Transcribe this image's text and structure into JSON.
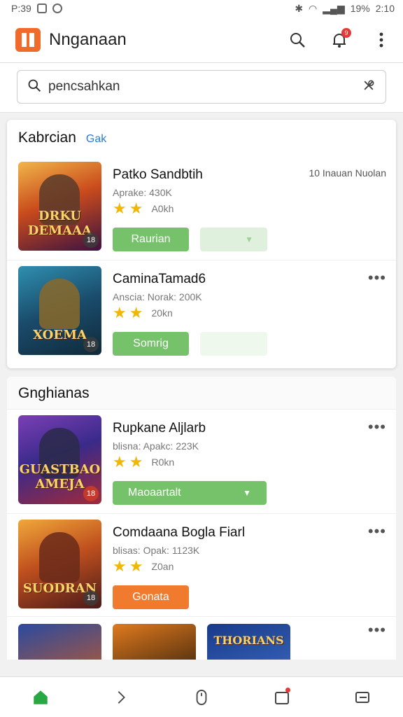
{
  "status": {
    "left": "P:39",
    "battery": "19%",
    "time": "2:10"
  },
  "app": {
    "title": "Nnganaan",
    "notification_count": "9"
  },
  "search": {
    "value": "pencsahkan"
  },
  "featured": {
    "title": "Kabrcian",
    "link": "Gak",
    "games": [
      {
        "title": "Patko Sandbtih",
        "meta": "Aprake: 430K",
        "size": "A0kh",
        "note": "10  Inauan Nuolan",
        "primary": "Raurian",
        "thumb_text": "DRKU DEMAAA",
        "thumb_badge": "18",
        "theme": "a"
      },
      {
        "title": "CaminaTamad6",
        "meta": "Anscia: Norak: 200K",
        "size": "20kn",
        "primary": "Somrig",
        "thumb_text": "XOEMA",
        "thumb_badge": "18",
        "theme": "b"
      }
    ]
  },
  "section2": {
    "title": "Gnghianas",
    "games": [
      {
        "title": "Rupkane Aljlarb",
        "meta": "blisna: Apakc: 223K",
        "size": "R0kn",
        "primary": "Maoaartalt",
        "button": "wide",
        "thumb_text": "GUASTBAO AMEJA",
        "thumb_badge": "18",
        "theme": "c"
      },
      {
        "title": "Comdaana Bogla Fiarl",
        "meta": "blisas: Opak: 1123K",
        "size": "Z0an",
        "primary": "Gonata",
        "button": "orange",
        "thumb_text": "SUODRAN",
        "thumb_badge": "18",
        "theme": "d"
      }
    ],
    "partial": [
      {
        "thumb_text": "",
        "theme": "e"
      },
      {
        "thumb_text": "",
        "theme": "f"
      },
      {
        "thumb_text": "THORIANS",
        "theme": "g"
      }
    ]
  },
  "colors": {
    "accent_green": "#76c26a",
    "accent_orange": "#f07b2e",
    "logo": "#f06a2a",
    "link": "#2b7bd6"
  }
}
